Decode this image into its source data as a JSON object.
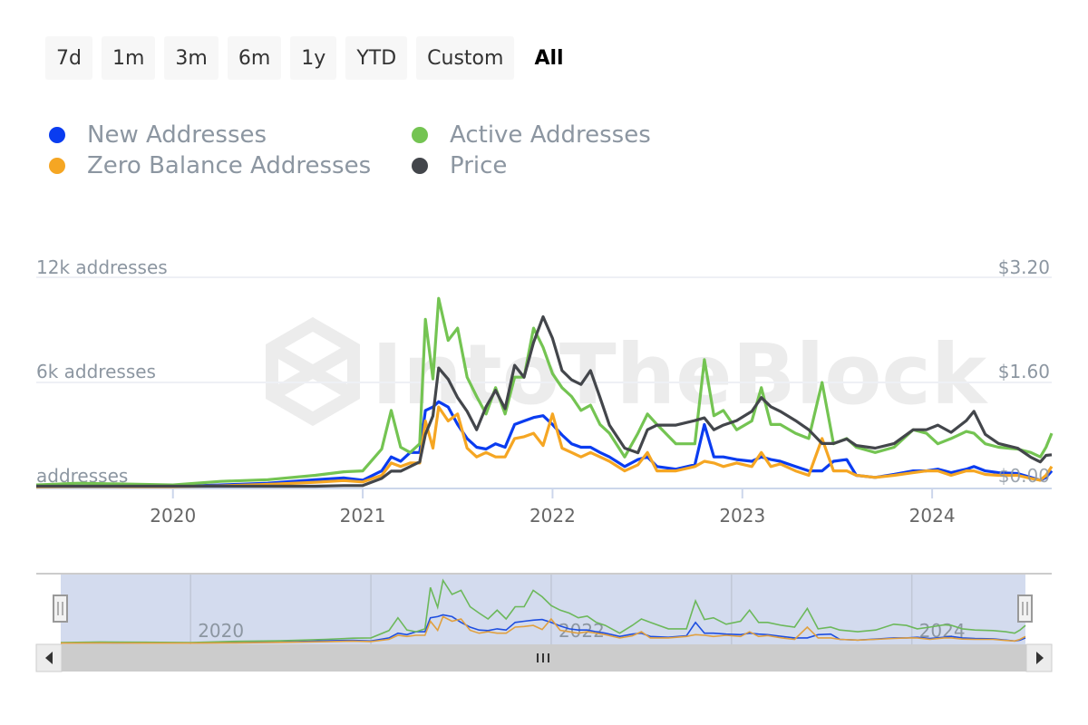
{
  "range_selector": {
    "buttons": [
      {
        "label": "7d",
        "active": false
      },
      {
        "label": "1m",
        "active": false
      },
      {
        "label": "3m",
        "active": false
      },
      {
        "label": "6m",
        "active": false
      },
      {
        "label": "1y",
        "active": false
      },
      {
        "label": "YTD",
        "active": false
      },
      {
        "label": "Custom",
        "active": false
      },
      {
        "label": "All",
        "active": true
      }
    ]
  },
  "watermark": "IntoTheBlock",
  "chart_data": {
    "type": "line",
    "title": "",
    "legend": [
      {
        "name": "New Addresses",
        "color": "#0a3cf0"
      },
      {
        "name": "Active Addresses",
        "color": "#74c452"
      },
      {
        "name": "Zero Balance Addresses",
        "color": "#f5a623"
      },
      {
        "name": "Price",
        "color": "#43464b"
      }
    ],
    "legend_position": "top-left",
    "x_ticks": [
      "2020",
      "2021",
      "2022",
      "2023",
      "2024"
    ],
    "x_range": [
      2019.28,
      2024.63
    ],
    "y_left": {
      "label_suffix": " addresses",
      "ticks": [
        "addresses",
        "6k addresses",
        "12k addresses"
      ],
      "range": [
        0,
        12000
      ]
    },
    "y_right": {
      "ticks": [
        "$0.00",
        "$1.60",
        "$3.20"
      ],
      "range": [
        0,
        3.2
      ]
    },
    "grid": true,
    "x": [
      2019.28,
      2019.5,
      2019.75,
      2020.0,
      2020.25,
      2020.5,
      2020.75,
      2020.9,
      2021.0,
      2021.1,
      2021.15,
      2021.2,
      2021.25,
      2021.3,
      2021.33,
      2021.37,
      2021.4,
      2021.45,
      2021.5,
      2021.55,
      2021.6,
      2021.65,
      2021.7,
      2021.75,
      2021.8,
      2021.85,
      2021.9,
      2021.95,
      2022.0,
      2022.05,
      2022.1,
      2022.15,
      2022.2,
      2022.25,
      2022.3,
      2022.38,
      2022.45,
      2022.5,
      2022.55,
      2022.65,
      2022.75,
      2022.8,
      2022.85,
      2022.9,
      2022.97,
      2023.05,
      2023.1,
      2023.15,
      2023.2,
      2023.28,
      2023.35,
      2023.42,
      2023.48,
      2023.55,
      2023.6,
      2023.7,
      2023.8,
      2023.9,
      2023.97,
      2024.03,
      2024.1,
      2024.18,
      2024.22,
      2024.28,
      2024.35,
      2024.45,
      2024.52,
      2024.57,
      2024.6,
      2024.63
    ],
    "series": [
      {
        "name": "Active Addresses",
        "axis": "left",
        "color": "#74c452",
        "values": [
          150,
          250,
          200,
          150,
          350,
          450,
          700,
          900,
          950,
          2200,
          4400,
          2300,
          2000,
          2500,
          9600,
          6200,
          10800,
          8400,
          9100,
          6300,
          5200,
          4200,
          5700,
          4200,
          6300,
          6300,
          9100,
          8000,
          6500,
          5700,
          5200,
          4400,
          4700,
          3600,
          3100,
          1750,
          3100,
          4200,
          3600,
          2500,
          2500,
          7300,
          4100,
          4400,
          3300,
          3800,
          5700,
          3600,
          3600,
          3100,
          2800,
          6000,
          2500,
          2800,
          2300,
          2000,
          2300,
          3300,
          3100,
          2500,
          2800,
          3200,
          3100,
          2500,
          2300,
          2200,
          2000,
          1750,
          2300,
          3100
        ]
      },
      {
        "name": "New Addresses",
        "axis": "left",
        "color": "#0a3cf0",
        "values": [
          60,
          80,
          60,
          60,
          150,
          250,
          450,
          550,
          420,
          950,
          1750,
          1500,
          2000,
          2000,
          4400,
          4600,
          4900,
          4600,
          3600,
          2800,
          2300,
          2200,
          2500,
          2300,
          3600,
          3800,
          4000,
          4100,
          3600,
          3000,
          2500,
          2300,
          2300,
          2000,
          1750,
          1200,
          1600,
          1750,
          1200,
          1050,
          1300,
          3600,
          1750,
          1750,
          1600,
          1500,
          1750,
          1600,
          1500,
          1200,
          950,
          950,
          1500,
          1600,
          700,
          580,
          750,
          950,
          950,
          1050,
          850,
          1050,
          1200,
          950,
          850,
          800,
          580,
          420,
          580,
          950
        ]
      },
      {
        "name": "Zero Balance Addresses",
        "axis": "left",
        "color": "#f5a623",
        "values": [
          40,
          60,
          50,
          50,
          100,
          180,
          300,
          400,
          320,
          700,
          1400,
          1200,
          1400,
          1400,
          3800,
          2250,
          4600,
          3800,
          4200,
          2250,
          1750,
          2000,
          1750,
          1750,
          2800,
          2900,
          3100,
          2400,
          4200,
          2250,
          2000,
          1750,
          2000,
          1750,
          1500,
          950,
          1300,
          2000,
          950,
          950,
          1200,
          1500,
          1400,
          1200,
          1400,
          1200,
          2000,
          1200,
          1350,
          950,
          700,
          2800,
          950,
          950,
          700,
          580,
          700,
          850,
          950,
          950,
          700,
          950,
          950,
          750,
          700,
          700,
          520,
          420,
          700,
          1200
        ]
      },
      {
        "name": "Price",
        "axis": "right",
        "color": "#43464b",
        "values": [
          0.02,
          0.02,
          0.02,
          0.02,
          0.02,
          0.02,
          0.02,
          0.03,
          0.03,
          0.14,
          0.25,
          0.25,
          0.32,
          0.39,
          0.81,
          1.09,
          1.82,
          1.65,
          1.37,
          1.16,
          0.88,
          1.23,
          1.48,
          1.2,
          1.86,
          1.68,
          2.21,
          2.6,
          2.27,
          1.78,
          1.64,
          1.57,
          1.78,
          1.37,
          0.95,
          0.6,
          0.53,
          0.88,
          0.95,
          0.95,
          1.02,
          1.06,
          0.88,
          0.95,
          1.02,
          1.16,
          1.37,
          1.23,
          1.16,
          1.02,
          0.88,
          0.67,
          0.67,
          0.74,
          0.64,
          0.6,
          0.67,
          0.88,
          0.88,
          0.95,
          0.84,
          1.02,
          1.16,
          0.81,
          0.67,
          0.6,
          0.46,
          0.39,
          0.49,
          0.5
        ]
      }
    ]
  },
  "navigator": {
    "x_ticks": [
      "2020",
      "2022",
      "2024"
    ]
  }
}
